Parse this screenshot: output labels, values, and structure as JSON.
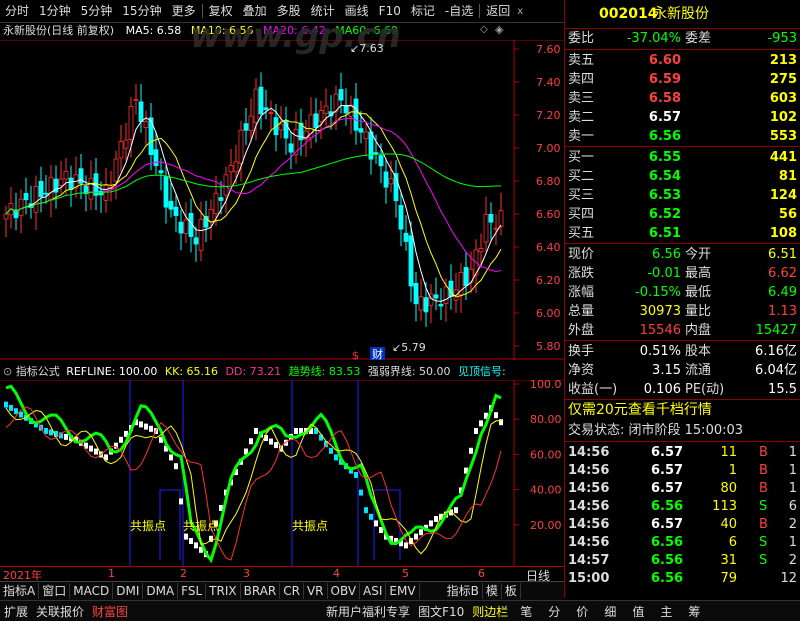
{
  "toolbar": {
    "items": [
      "分时",
      "1分钟",
      "5分钟",
      "15分钟",
      "更多",
      "复权",
      "叠加",
      "多股",
      "统计",
      "画线",
      "F10",
      "标记",
      "-自选",
      "返回"
    ],
    "close": "x"
  },
  "main": {
    "title": "永新股份(日线 前复权)",
    "ma5": "MA5: 6.58",
    "ma10": "MA10: 6.56",
    "ma20": "MA20: 6.42",
    "ma60": "MA60: 6.69",
    "watermark": "www.gp.cn",
    "high_label": "7.63",
    "low_label": "5.79",
    "event_s": "$",
    "event_cai": "财",
    "yticks": [
      "7.60",
      "7.40",
      "7.20",
      "7.00",
      "6.80",
      "6.60",
      "6.40",
      "6.20",
      "6.00",
      "5.80"
    ],
    "colors": {
      "ma5": "#ffffff",
      "ma10": "#ffff00",
      "ma20": "#ff00ff",
      "ma60": "#00ff00",
      "up": "#ff3030",
      "down": "#00ffff"
    }
  },
  "indicator": {
    "name": "指标公式",
    "refline": "REFLINE: 100.00",
    "kk": "KK: 65.16",
    "dd": "DD: 73.21",
    "trend": "趋势线: 83.53",
    "strong": "强弱界线: 50.00",
    "top": "见顶信号:",
    "yticks": [
      "100.0",
      "80.00",
      "60.00",
      "40.00",
      "20.00"
    ],
    "resonance": [
      "共振点",
      "共振点",
      "共振点"
    ]
  },
  "xaxis": {
    "labels": [
      "2021年",
      "1",
      "2",
      "3",
      "4",
      "5",
      "6"
    ],
    "period": "日线"
  },
  "tabs": [
    "指标A",
    "窗口",
    "MACD",
    "DMI",
    "DMA",
    "FSL",
    "TRIX",
    "BRAR",
    "CR",
    "VR",
    "OBV",
    "ASI",
    "EMV",
    "指标B",
    "模",
    "板"
  ],
  "status": [
    "扩展",
    "关联报价",
    "财富图",
    "新用户福利专享",
    "图文F10",
    "则边栏",
    "笔",
    "分",
    "价",
    "细",
    "值",
    "主",
    "筹"
  ],
  "quote": {
    "code": "002014",
    "name": "永新股份",
    "weibi_label": "委比",
    "weibi": "-37.04%",
    "weicha_label": "委差",
    "weicha": "-953",
    "asks": [
      [
        "卖五",
        "6.60",
        "213"
      ],
      [
        "卖四",
        "6.59",
        "275"
      ],
      [
        "卖三",
        "6.58",
        "603"
      ],
      [
        "卖二",
        "6.57",
        "102"
      ],
      [
        "卖一",
        "6.56",
        "553"
      ]
    ],
    "bids": [
      [
        "买一",
        "6.55",
        "441"
      ],
      [
        "买二",
        "6.54",
        "81"
      ],
      [
        "买三",
        "6.53",
        "124"
      ],
      [
        "买四",
        "6.52",
        "56"
      ],
      [
        "买五",
        "6.51",
        "108"
      ]
    ],
    "stats": [
      [
        "现价",
        "6.56",
        "今开",
        "6.51"
      ],
      [
        "涨跌",
        "-0.01",
        "最高",
        "6.62"
      ],
      [
        "涨幅",
        "-0.15%",
        "最低",
        "6.49"
      ],
      [
        "总量",
        "30973",
        "量比",
        "1.13"
      ],
      [
        "外盘",
        "15546",
        "内盘",
        "15427"
      ]
    ],
    "stats2": [
      [
        "换手",
        "0.51%",
        "股本",
        "6.16亿"
      ],
      [
        "净资",
        "3.15",
        "流通",
        "6.04亿"
      ],
      [
        "收益(一)",
        "0.106",
        "PE(动)",
        "15.5"
      ]
    ],
    "promo": "仅需20元查看千档行情",
    "trade_state": "交易状态: 闭市阶段 15:00:03",
    "ticks": [
      [
        "14:56",
        "6.57",
        "11",
        "B",
        "1"
      ],
      [
        "14:56",
        "6.57",
        "1",
        "B",
        "1"
      ],
      [
        "14:56",
        "6.57",
        "80",
        "B",
        "1"
      ],
      [
        "14:56",
        "6.56",
        "113",
        "S",
        "6"
      ],
      [
        "14:56",
        "6.57",
        "40",
        "B",
        "2"
      ],
      [
        "14:56",
        "6.56",
        "6",
        "S",
        "1"
      ],
      [
        "14:57",
        "6.56",
        "31",
        "S",
        "2"
      ],
      [
        "15:00",
        "6.56",
        "79",
        "",
        "12"
      ]
    ]
  }
}
